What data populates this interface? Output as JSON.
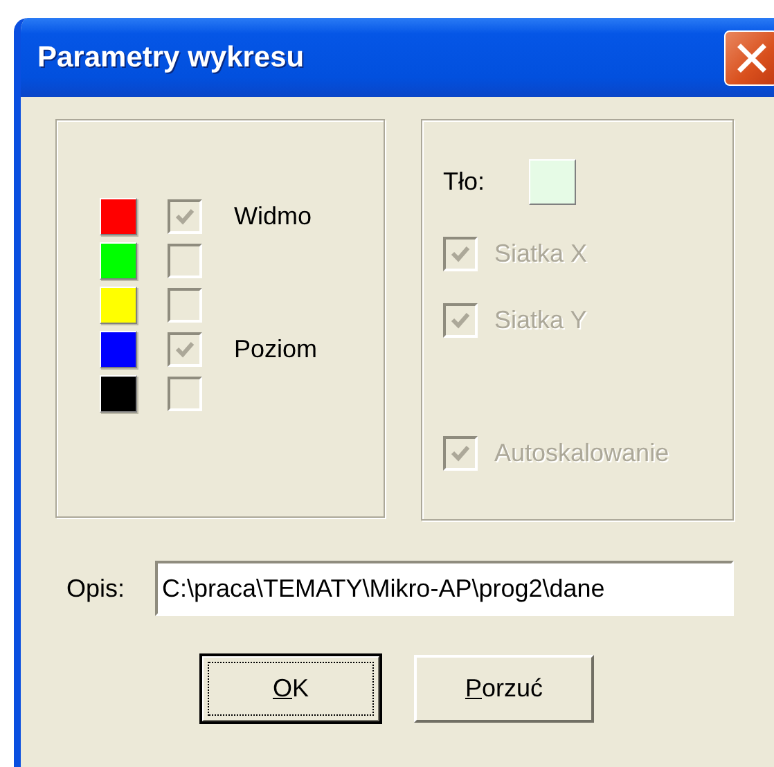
{
  "window": {
    "title": "Parametry wykresu"
  },
  "series": [
    {
      "color": "#ff0000",
      "checked": true,
      "disabled": true,
      "label": "Widmo"
    },
    {
      "color": "#00ff00",
      "checked": false,
      "disabled": true
    },
    {
      "color": "#ffff00",
      "checked": false,
      "disabled": true
    },
    {
      "color": "#0000ff",
      "checked": true,
      "disabled": true,
      "label": "Poziom"
    },
    {
      "color": "#000000",
      "checked": false,
      "disabled": true
    }
  ],
  "background": {
    "label": "Tło:",
    "color": "#e6fbe6"
  },
  "options": [
    {
      "label": "Siatka X",
      "checked": true,
      "disabled": true
    },
    {
      "label": "Siatka Y",
      "checked": true,
      "disabled": true
    },
    {
      "label": "Autoskalowanie",
      "checked": true,
      "disabled": true
    }
  ],
  "description": {
    "label": "Opis:",
    "value": "C:\\praca\\TEMATY\\Mikro-AP\\prog2\\dane"
  },
  "buttons": [
    {
      "label": "OK",
      "default": true,
      "underline_first": true
    },
    {
      "label": "Porzuć",
      "default": false,
      "underline_first": true
    }
  ]
}
